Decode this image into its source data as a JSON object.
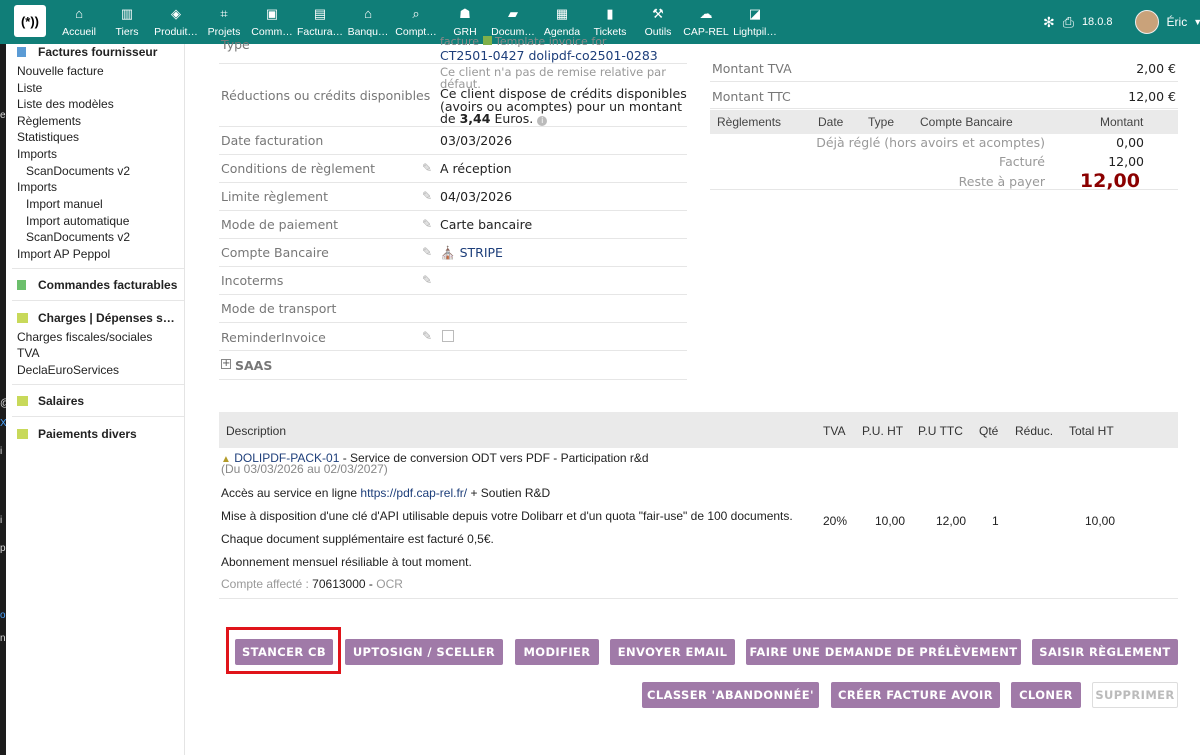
{
  "topbar": {
    "menu": [
      {
        "label": "Accueil",
        "icon": "home-icon"
      },
      {
        "label": "Tiers",
        "icon": "building-icon"
      },
      {
        "label": "Produit…",
        "icon": "cube-icon"
      },
      {
        "label": "Projets",
        "icon": "sitemap-icon"
      },
      {
        "label": "Comm…",
        "icon": "briefcase-icon"
      },
      {
        "label": "Factura…",
        "icon": "money-icon"
      },
      {
        "label": "Banqu…",
        "icon": "bank-icon"
      },
      {
        "label": "Compt…",
        "icon": "search-dollar-icon"
      },
      {
        "label": "GRH",
        "icon": "user-tie-icon"
      },
      {
        "label": "Docum…",
        "icon": "folder-icon"
      },
      {
        "label": "Agenda",
        "icon": "calendar-icon"
      },
      {
        "label": "Tickets",
        "icon": "ticket-icon"
      },
      {
        "label": "Outils",
        "icon": "wrench-icon"
      },
      {
        "label": "CAP-REL",
        "icon": "cloud-icon"
      },
      {
        "label": "Lightpil…",
        "icon": "note-icon"
      }
    ],
    "version": "18.0.8",
    "user": "Éric"
  },
  "sidebar": {
    "factures_fournisseur": "Factures fournisseur",
    "items1": [
      "Nouvelle facture",
      "Liste",
      "Liste des modèles",
      "Règlements",
      "Statistiques",
      "Imports"
    ],
    "scan1": "ScanDocuments v2",
    "imports2": "Imports",
    "sub2": [
      "Import manuel",
      "Import automatique",
      "ScanDocuments v2"
    ],
    "import_ap": "Import AP Peppol",
    "commandes": "Commandes facturables",
    "charges": "Charges | Dépenses s…",
    "charges_items": [
      "Charges fiscales/sociales",
      "TVA",
      "DeclaEuroServices"
    ],
    "salaires": "Salaires",
    "paiements": "Paiements divers"
  },
  "left_strip": [
    "e",
    "@",
    "X",
    "i",
    "i",
    "p",
    "o",
    "n"
  ],
  "fields": {
    "type_label": "Type",
    "type_line1": "facture",
    "type_line1b": "Template invoice for",
    "type_line2": "CT2501-0427 dolipdf-co2501-0283",
    "reduc_label": "Réductions ou crédits disponibles",
    "reduc_note1": "Ce client n'a pas de remise relative par",
    "reduc_note2": "défaut.",
    "reduc_text1": "Ce client dispose de crédits disponibles",
    "reduc_text2": "(avoirs ou acomptes) pour un montant",
    "reduc_text3_pre": "de",
    "reduc_amount": "3,44",
    "reduc_text3_post": "Euros.",
    "date_label": "Date facturation",
    "date_value": "03/03/2026",
    "cond_label": "Conditions de règlement",
    "cond_value": "A réception",
    "limite_label": "Limite règlement",
    "limite_value": "04/03/2026",
    "mode_label": "Mode de paiement",
    "mode_value": "Carte bancaire",
    "compte_label": "Compte Bancaire",
    "compte_value": "STRIPE",
    "incoterms_label": "Incoterms",
    "transport_label": "Mode de transport",
    "reminder_label": "ReminderInvoice",
    "saas_label": "SAAS"
  },
  "totals": {
    "tva_label": "Montant TVA",
    "tva_value": "2,00 €",
    "ttc_label": "Montant TTC",
    "ttc_value": "12,00 €",
    "head": {
      "reglements": "Règlements",
      "date": "Date",
      "type": "Type",
      "compte": "Compte Bancaire",
      "montant": "Montant"
    },
    "deja_label": "Déjà réglé (hors avoirs et acomptes)",
    "deja_value": "0,00",
    "facture_label": "Facturé",
    "facture_value": "12,00",
    "reste_label": "Reste à payer",
    "reste_value": "12,00"
  },
  "lines": {
    "headers": {
      "description": "Description",
      "tva": "TVA",
      "pu_ht": "P.U. HT",
      "pu_ttc": "P.U TTC",
      "qte": "Qté",
      "reduc": "Réduc.",
      "total": "Total HT"
    },
    "product_ref": "DOLIPDF-PACK-01",
    "product_name": " - Service de conversion ODT vers PDF - Participation r&d",
    "period": "(Du 03/03/2026 au 02/03/2027)",
    "desc1_pre": "Accès au service en ligne ",
    "desc1_link": "https://pdf.cap-rel.fr/",
    "desc1_post": " + Soutien R&D",
    "desc2": "Mise à disposition d'une clé d'API utilisable depuis votre Dolibarr et d'un quota \"fair-use\" de 100 documents.",
    "desc3": "Chaque document supplémentaire est facturé 0,5€.",
    "desc4": "Abonnement mensuel résiliable à tout moment.",
    "compte_label": "Compte affecté : ",
    "compte_value": "70613000",
    "compte_sep": " - ",
    "compte_name": "OCR",
    "tva": "20%",
    "pu_ht": "10,00",
    "pu_ttc": "12,00",
    "qte": "1",
    "total": "10,00"
  },
  "buttons": {
    "stancer": "STANCER CB",
    "uptosign": "UPTOSIGN / SCELLER",
    "modifier": "MODIFIER",
    "email": "ENVOYER EMAIL",
    "prelevement": "FAIRE UNE DEMANDE DE PRÉLÈVEMENT",
    "reglement": "SAISIR RÈGLEMENT",
    "abandonnee": "CLASSER 'ABANDONNÉE'",
    "avoir": "CRÉER FACTURE AVOIR",
    "cloner": "CLONER",
    "supprimer": "SUPPRIMER"
  },
  "colors": {
    "topbar": "#107e78",
    "button": "#a07aa8",
    "highlight": "#e0141a",
    "reste": "#8b0000"
  }
}
